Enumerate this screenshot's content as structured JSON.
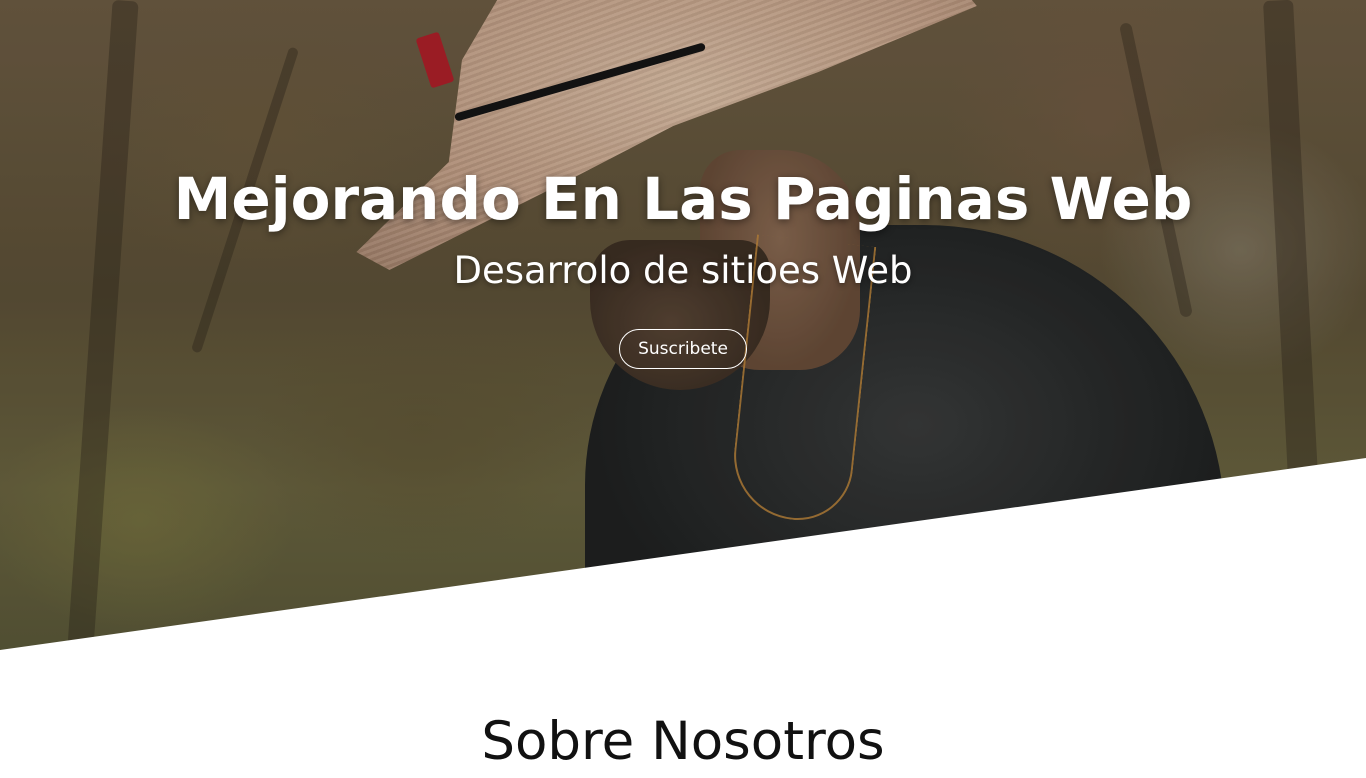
{
  "hero": {
    "title": "Mejorando En Las Paginas Web",
    "subtitle": "Desarrolo de sitioes Web",
    "button_label": "Suscribete",
    "background_image": "man-with-straw-hat-photo"
  },
  "about": {
    "heading": "Sobre Nosotros"
  },
  "colors": {
    "text_light": "#ffffff",
    "text_dark": "#111111",
    "background": "#ffffff"
  }
}
